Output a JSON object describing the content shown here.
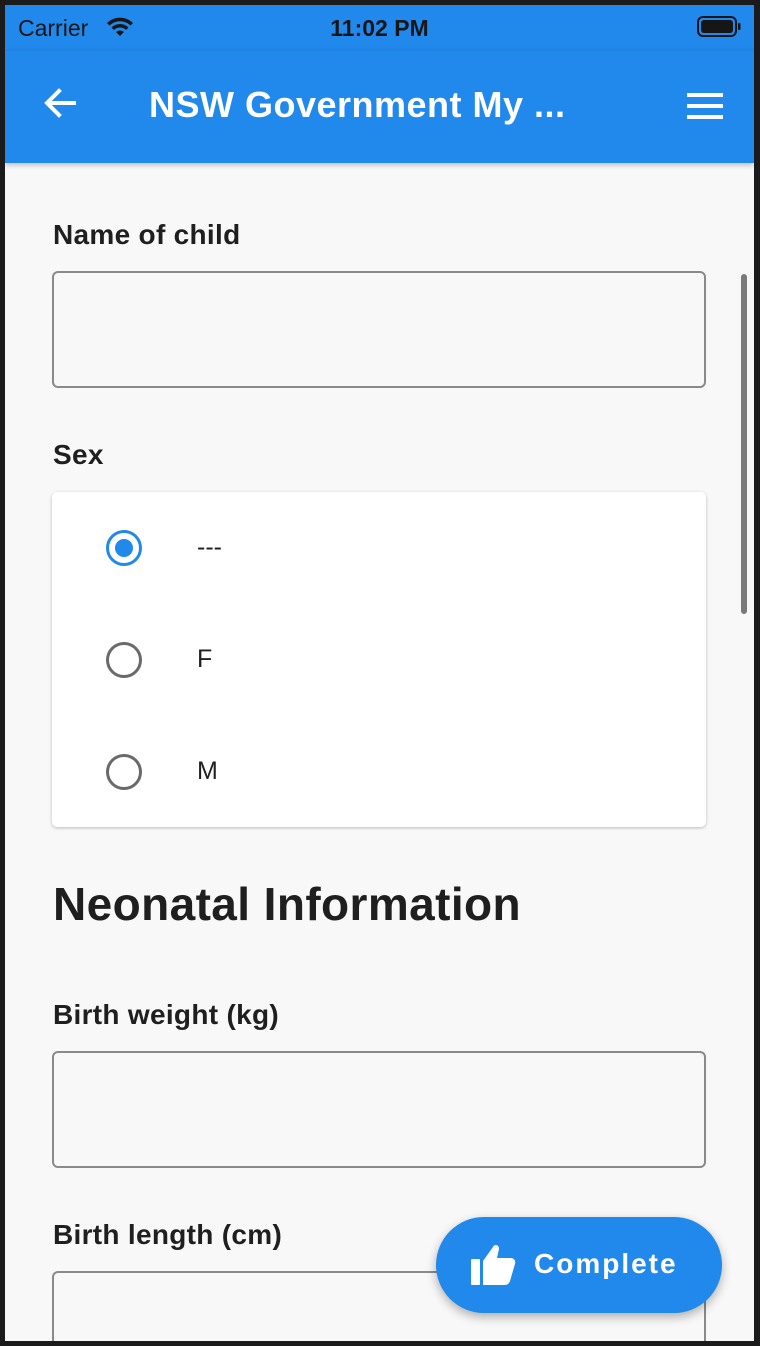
{
  "status_bar": {
    "carrier": "Carrier",
    "time": "11:02 PM",
    "wifi_icon": "wifi-icon",
    "battery_icon": "battery-icon"
  },
  "app_bar": {
    "title": "NSW Government My ...",
    "back_icon": "arrow-left-icon",
    "menu_icon": "hamburger-menu-icon",
    "background_color": "#2189eb"
  },
  "form": {
    "name_of_child": {
      "label": "Name of child",
      "value": "",
      "placeholder": ""
    },
    "sex": {
      "label": "Sex",
      "options": [
        {
          "label": "---",
          "selected": true
        },
        {
          "label": "F",
          "selected": false
        },
        {
          "label": "M",
          "selected": false
        }
      ]
    },
    "neonatal_section": {
      "heading": "Neonatal Information"
    },
    "birth_weight": {
      "label": "Birth weight (kg)",
      "value": "",
      "placeholder": ""
    },
    "birth_length": {
      "label": "Birth length (cm)",
      "value": "",
      "placeholder": ""
    }
  },
  "fab": {
    "label": "Complete",
    "icon": "thumbs-up-icon",
    "color": "#2189eb"
  }
}
